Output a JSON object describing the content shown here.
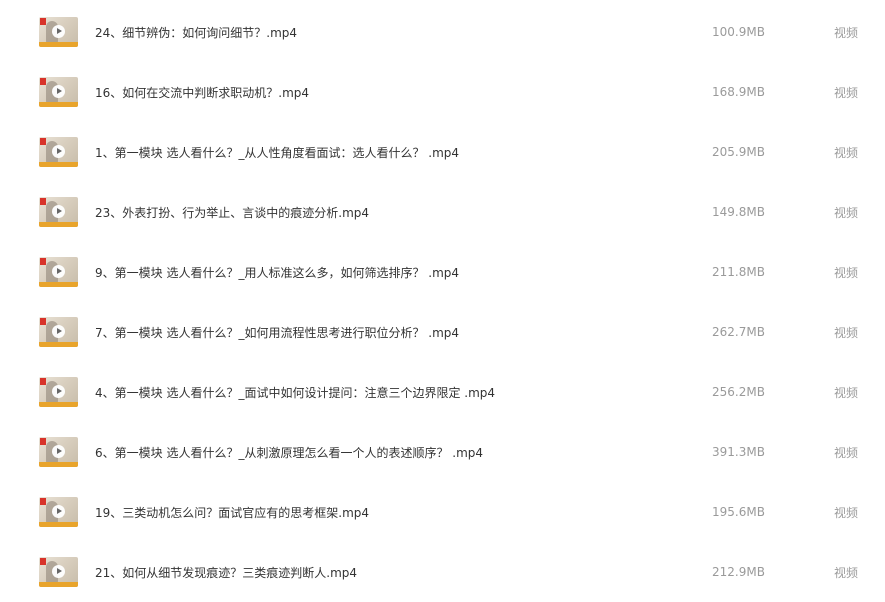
{
  "files": [
    {
      "name": "24、细节辨伪：如何询问细节？.mp4",
      "size": "100.9MB",
      "type": "视频",
      "thumb_icon": "video-thumbnail"
    },
    {
      "name": "16、如何在交流中判断求职动机？.mp4",
      "size": "168.9MB",
      "type": "视频",
      "thumb_icon": "video-thumbnail"
    },
    {
      "name": "1、第一模块  选人看什么？_从人性角度看面试：选人看什么？ .mp4",
      "size": "205.9MB",
      "type": "视频",
      "thumb_icon": "video-thumbnail"
    },
    {
      "name": "23、外表打扮、行为举止、言谈中的痕迹分析.mp4",
      "size": "149.8MB",
      "type": "视频",
      "thumb_icon": "video-thumbnail"
    },
    {
      "name": "9、第一模块  选人看什么？_用人标准这么多，如何筛选排序？ .mp4",
      "size": "211.8MB",
      "type": "视频",
      "thumb_icon": "video-thumbnail"
    },
    {
      "name": "7、第一模块  选人看什么？_如何用流程性思考进行职位分析？ .mp4",
      "size": "262.7MB",
      "type": "视频",
      "thumb_icon": "video-thumbnail"
    },
    {
      "name": "4、第一模块  选人看什么？_面试中如何设计提问：注意三个边界限定 .mp4",
      "size": "256.2MB",
      "type": "视频",
      "thumb_icon": "video-thumbnail"
    },
    {
      "name": "6、第一模块  选人看什么？_从刺激原理怎么看一个人的表述顺序？ .mp4",
      "size": "391.3MB",
      "type": "视频",
      "thumb_icon": "video-thumbnail"
    },
    {
      "name": "19、三类动机怎么问？面试官应有的思考框架.mp4",
      "size": "195.6MB",
      "type": "视频",
      "thumb_icon": "video-thumbnail"
    },
    {
      "name": "21、如何从细节发现痕迹？三类痕迹判断人.mp4",
      "size": "212.9MB",
      "type": "视频",
      "thumb_icon": "video-thumbnail"
    }
  ]
}
